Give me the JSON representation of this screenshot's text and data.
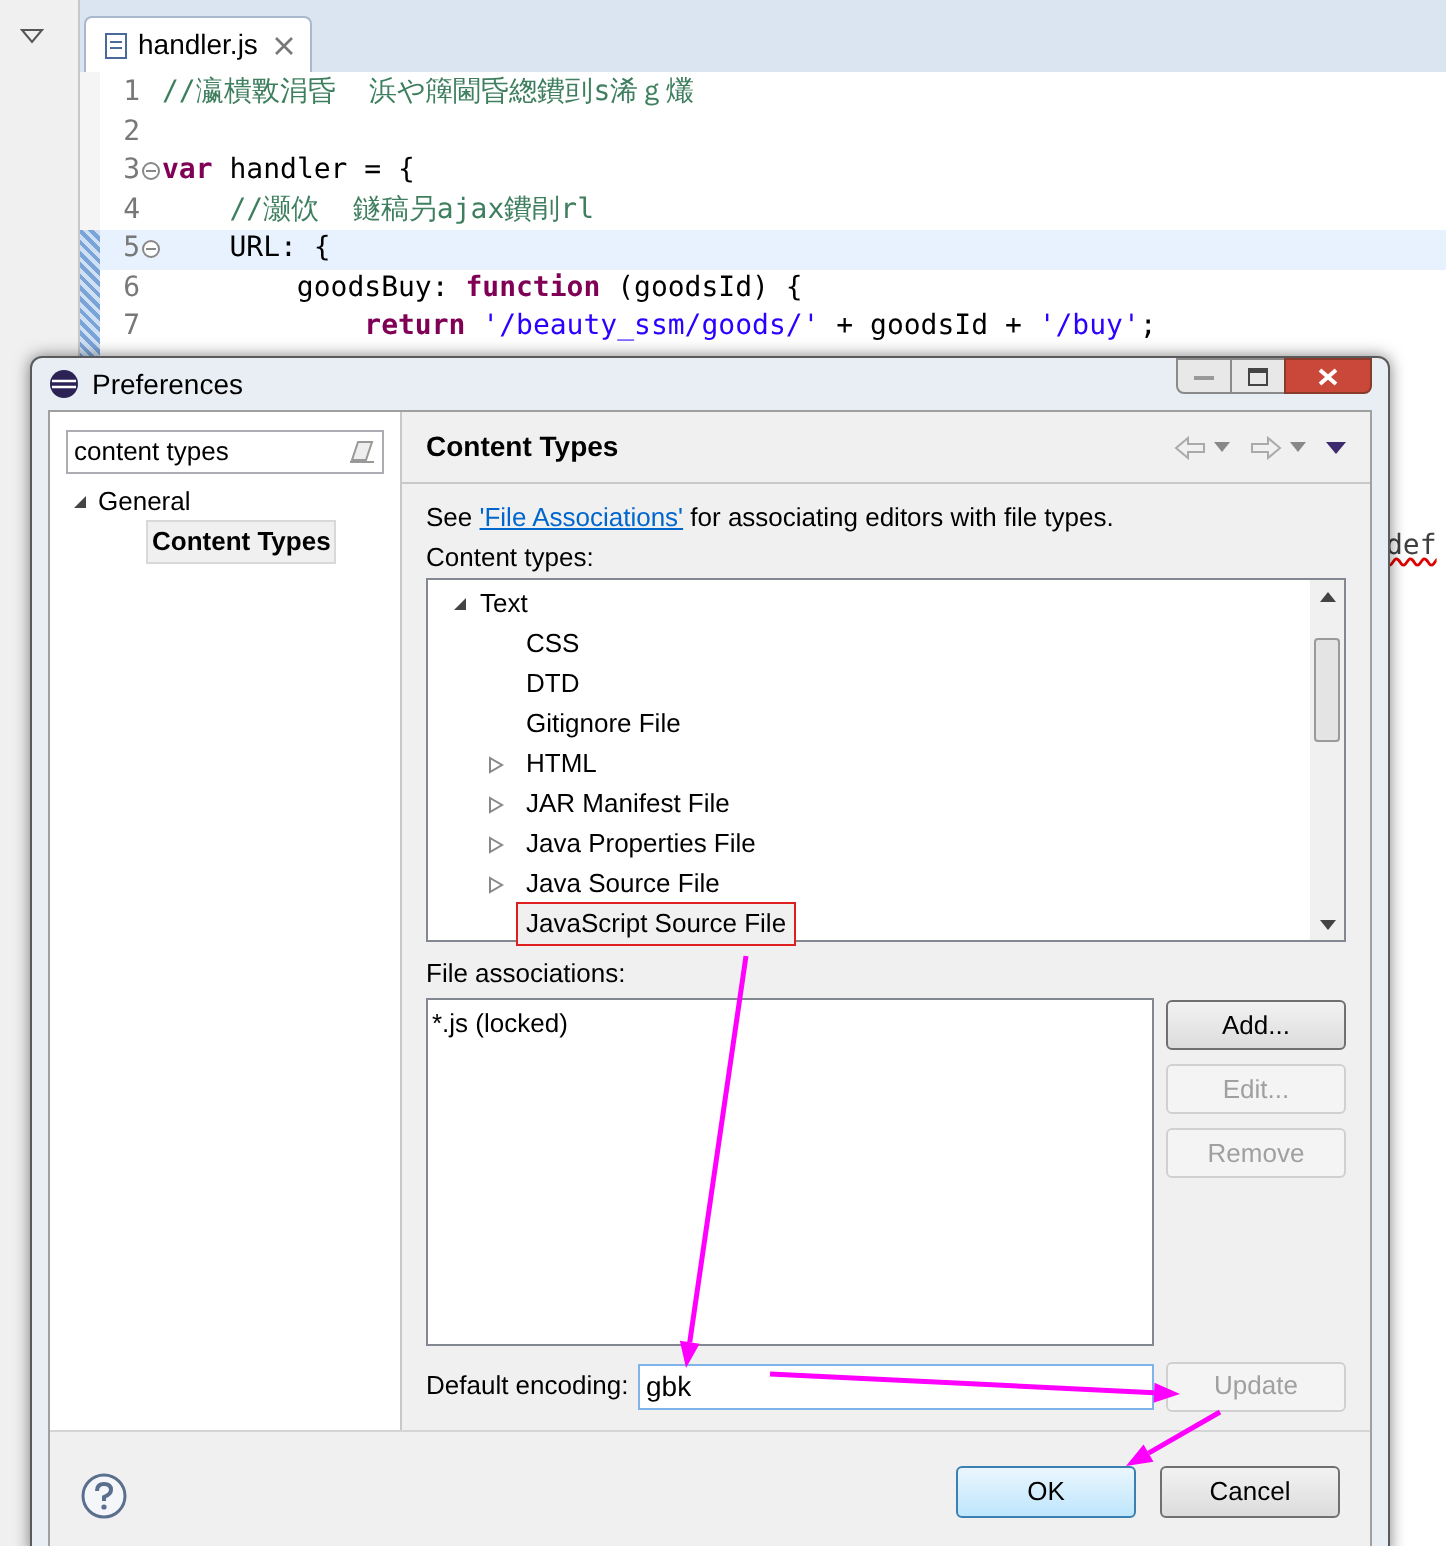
{
  "editor": {
    "tab": {
      "title": "handler.js"
    },
    "lines": [
      {
        "number": "1",
        "fold": false,
        "current": false,
        "tokens": [
          {
            "kind": "comment",
            "text": "//瀛樻斁涓昏  浜や簰閫昏緫鐨刯s浠ｇ爜"
          }
        ]
      },
      {
        "number": "2",
        "fold": false,
        "current": false
      },
      {
        "number": "3",
        "fold": true,
        "current": false,
        "tokens": [
          {
            "kind": "keyword",
            "text": "var"
          },
          {
            "kind": "plain",
            "text": " handler = {"
          }
        ]
      },
      {
        "number": "4",
        "fold": false,
        "current": false,
        "tokens": [
          {
            "kind": "comment",
            "text": "    //灏佽  鐩稿叧ajax鐨剈rl"
          }
        ]
      },
      {
        "number": "5",
        "fold": true,
        "current": true,
        "tokens": [
          {
            "kind": "plain",
            "text": "    URL: {"
          }
        ]
      },
      {
        "number": "6",
        "fold": false,
        "current": false,
        "tokens": [
          {
            "kind": "plain",
            "text": "        goodsBuy: "
          },
          {
            "kind": "keyword",
            "text": "function"
          },
          {
            "kind": "plain",
            "text": " (goodsId) {"
          }
        ]
      },
      {
        "number": "7",
        "fold": false,
        "current": false,
        "tokens": [
          {
            "kind": "keyword",
            "text": "            return "
          },
          {
            "kind": "string",
            "text": "'/beauty_ssm/goods/'"
          },
          {
            "kind": "plain",
            "text": " + goodsId + "
          },
          {
            "kind": "string",
            "text": "'/buy'"
          },
          {
            "kind": "plain",
            "text": ";"
          }
        ]
      }
    ],
    "side_fragment": "def"
  },
  "dialog": {
    "title": "Preferences",
    "filter": {
      "value": "content types"
    },
    "tree": [
      {
        "label": "General",
        "expanded": true,
        "children": [
          {
            "label": "Content Types",
            "selected": true
          }
        ]
      }
    ],
    "page": {
      "title": "Content Types",
      "intro": {
        "before": "See ",
        "link": "'File Associations'",
        "after": " for associating editors with file types."
      },
      "content_types_label": "Content types:",
      "content_types": [
        {
          "label": "Text",
          "expanded": true,
          "children": [
            {
              "label": "CSS",
              "expandable": false,
              "selected": false,
              "annotated": false
            },
            {
              "label": "DTD",
              "expandable": false,
              "selected": false,
              "annotated": false
            },
            {
              "label": "Gitignore File",
              "expandable": false,
              "selected": false,
              "annotated": false
            },
            {
              "label": "HTML",
              "expandable": true,
              "selected": false,
              "annotated": false
            },
            {
              "label": "JAR Manifest File",
              "expandable": true,
              "selected": false,
              "annotated": false
            },
            {
              "label": "Java Properties File",
              "expandable": true,
              "selected": false,
              "annotated": false
            },
            {
              "label": "Java Source File",
              "expandable": true,
              "selected": false,
              "annotated": false
            },
            {
              "label": "JavaScript Source File",
              "expandable": false,
              "selected": true,
              "annotated": true
            }
          ]
        }
      ],
      "file_associations_label": "File associations:",
      "file_associations": [
        "*.js (locked)"
      ],
      "association_buttons": [
        {
          "label": "Add...",
          "disabled": false
        },
        {
          "label": "Edit...",
          "disabled": true
        },
        {
          "label": "Remove",
          "disabled": true
        }
      ],
      "encoding": {
        "label": "Default encoding:",
        "value": "gbk",
        "button": {
          "label": "Update",
          "disabled": true
        }
      }
    },
    "footer_buttons": [
      {
        "label": "OK",
        "default": true
      },
      {
        "label": "Cancel",
        "default": false
      }
    ]
  }
}
